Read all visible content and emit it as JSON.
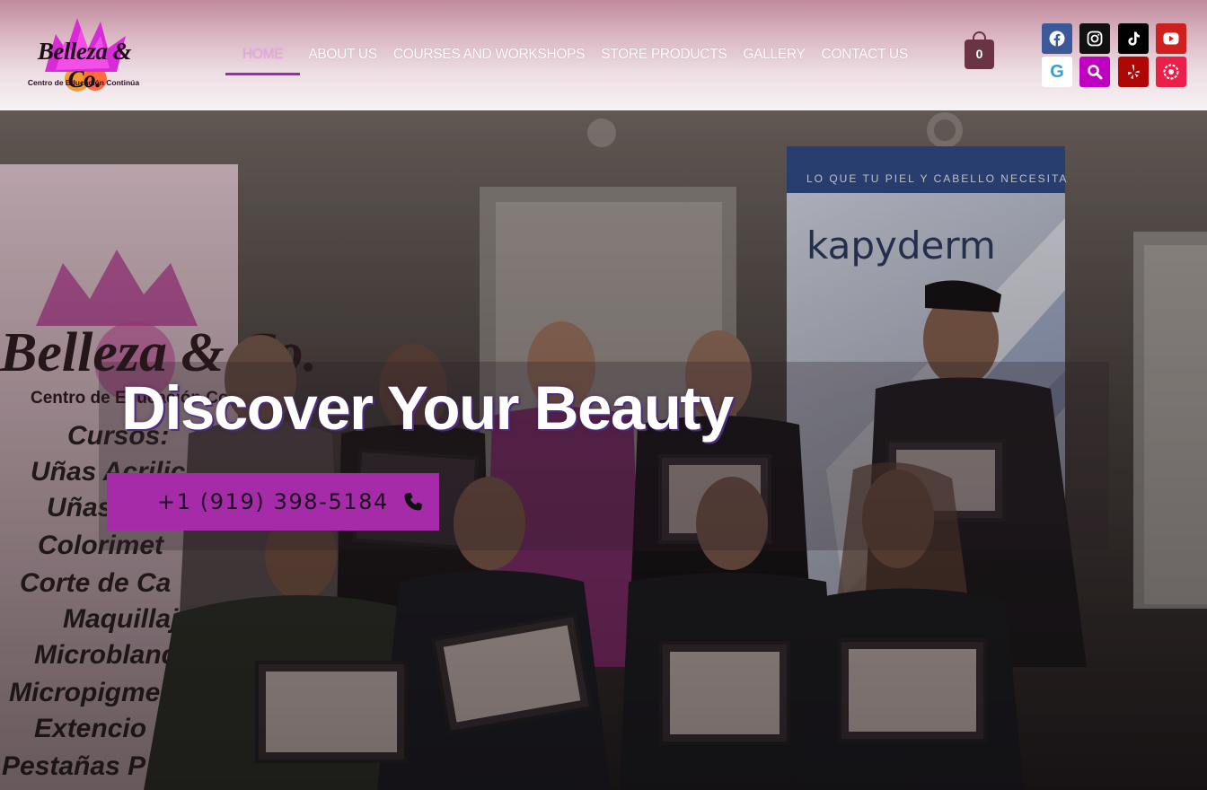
{
  "logo": {
    "brand": "Belleza & Co.",
    "tagline": "Centro de Educación Continúa"
  },
  "nav": {
    "items": [
      {
        "label": "HOME",
        "active": true
      },
      {
        "label": "ABOUT US"
      },
      {
        "label": "COURSES AND WORKSHOPS"
      },
      {
        "label": "STORE PRODUCTS"
      },
      {
        "label": "GALLERY"
      },
      {
        "label": "CONTACT US"
      }
    ]
  },
  "cart": {
    "count": "0"
  },
  "social": [
    {
      "name": "facebook-icon",
      "color": "#3b5998"
    },
    {
      "name": "instagram-icon",
      "color": "#111111"
    },
    {
      "name": "tiktok-icon",
      "color": "#000000"
    },
    {
      "name": "youtube-icon",
      "color": "#cd201f"
    },
    {
      "name": "google-icon",
      "color": "#ffffff"
    },
    {
      "name": "search-icon",
      "color": "#c000c0"
    },
    {
      "name": "yelp-icon",
      "color": "#af0606"
    },
    {
      "name": "custom-link-icon",
      "color": "#ea1f4a"
    }
  ],
  "hero": {
    "title": "Discover Your Beauty",
    "phone": "+1 (919) 398-5184"
  },
  "photo_text": {
    "wall_banner_top": "LO QUE TU PIEL Y CABELLO NECESITA",
    "wall_brand": "kapyderm",
    "left_banner_brand": "Belleza & Co.",
    "left_banner_sub": "Centro de Educación Continúa",
    "left_banner_lines": [
      "Cursos:",
      "Uñas Acrilica",
      "Uñas",
      "Colorimet",
      "Corte de Ca",
      "Maquillaje",
      "Microblandin",
      "Micropigme",
      "Extencio",
      "Pestañas P"
    ]
  },
  "colors": {
    "accent": "#a52ba8",
    "nav_active": "#e6a8e6",
    "cart": "#6b3445"
  }
}
